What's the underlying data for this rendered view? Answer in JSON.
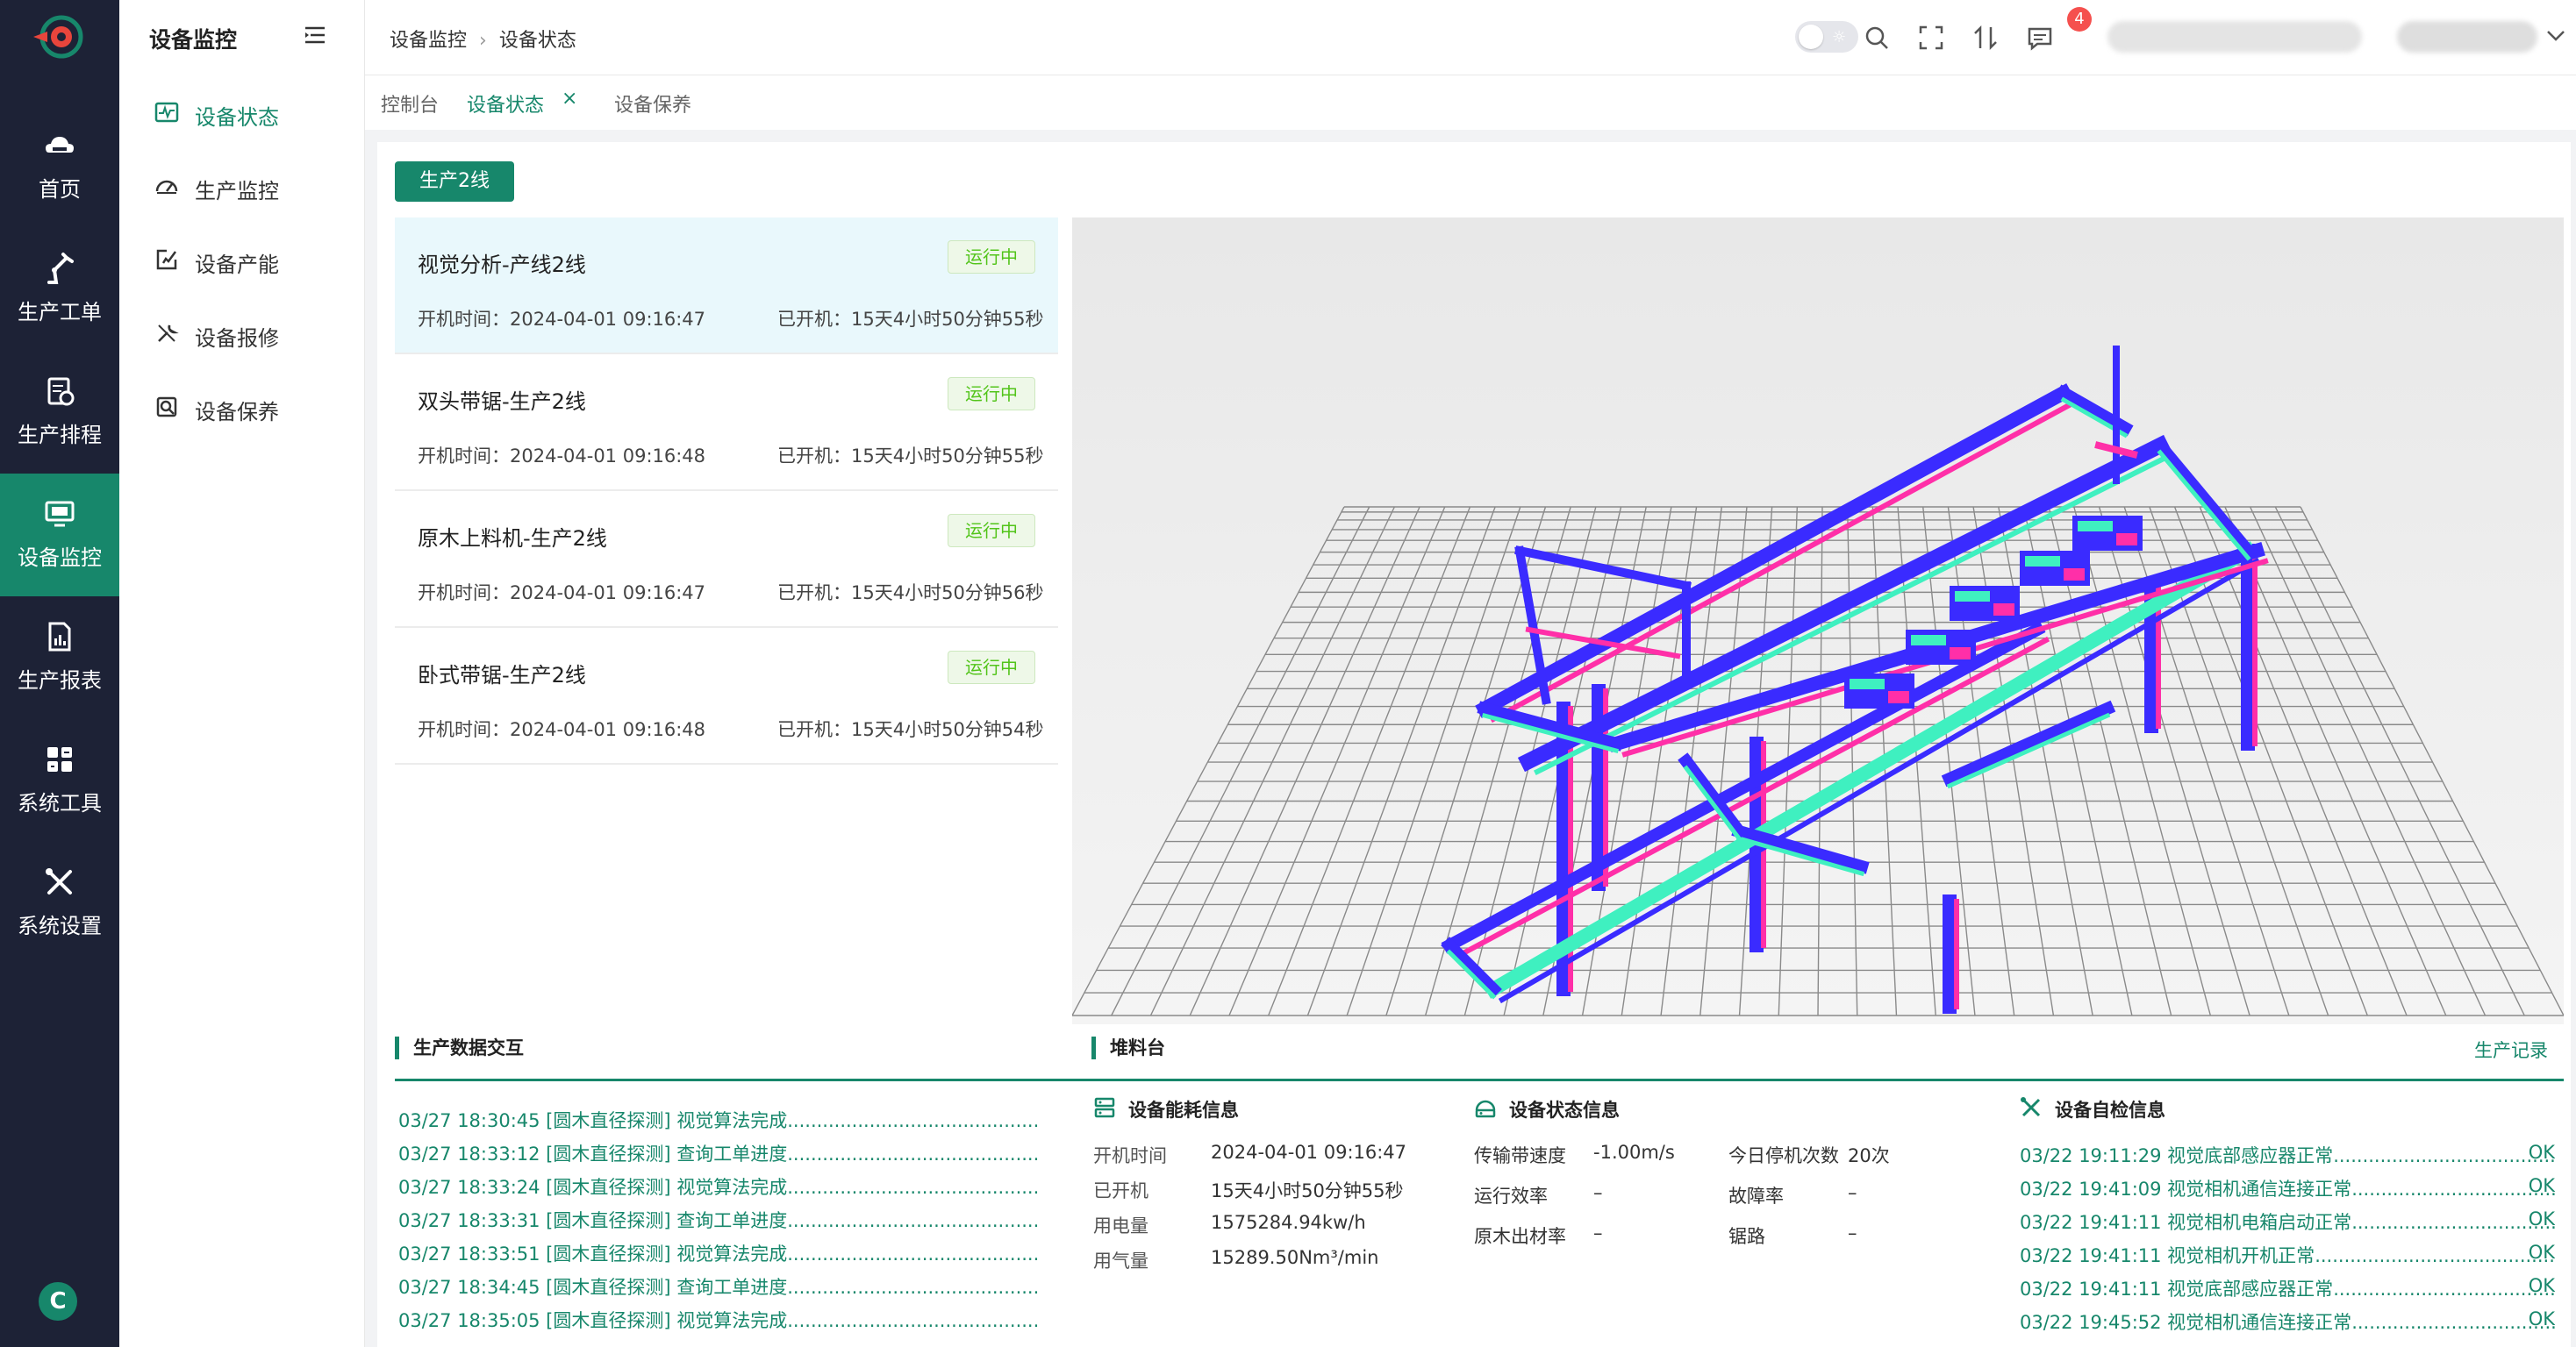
{
  "rail": {
    "items": [
      {
        "label": "首页",
        "icon": "home-cloud-icon"
      },
      {
        "label": "生产工单",
        "icon": "robot-arm-icon"
      },
      {
        "label": "生产排程",
        "icon": "schedule-clipboard-icon"
      },
      {
        "label": "设备监控",
        "icon": "monitor-icon"
      },
      {
        "label": "生产报表",
        "icon": "report-icon"
      },
      {
        "label": "系统工具",
        "icon": "grid-tools-icon"
      },
      {
        "label": "系统设置",
        "icon": "tools-cross-icon"
      }
    ],
    "active_index": 3,
    "bottom_logo": "C"
  },
  "sidebar": {
    "title": "设备监控",
    "items": [
      {
        "label": "设备状态",
        "icon": "waveform-icon"
      },
      {
        "label": "生产监控",
        "icon": "gauge-icon"
      },
      {
        "label": "设备产能",
        "icon": "edit-chart-icon"
      },
      {
        "label": "设备报修",
        "icon": "wrench-icon"
      },
      {
        "label": "设备保养",
        "icon": "maintenance-icon"
      }
    ],
    "active_index": 0
  },
  "header": {
    "breadcrumb": [
      "设备监控",
      "设备状态"
    ],
    "notification_count": "4"
  },
  "tabs": [
    {
      "label": "控制台"
    },
    {
      "label": "设备状态"
    },
    {
      "label": "设备保养"
    }
  ],
  "line_button": "生产2线",
  "devices": [
    {
      "name": "视觉分析-产线2线",
      "status": "运行中",
      "start": "开机时间：2024-04-01 09:16:47",
      "uptime": "已开机：15天4小时50分钟55秒"
    },
    {
      "name": "双头带锯-生产2线",
      "status": "运行中",
      "start": "开机时间：2024-04-01 09:16:48",
      "uptime": "已开机：15天4小时50分钟55秒"
    },
    {
      "name": "原木上料机-生产2线",
      "status": "运行中",
      "start": "开机时间：2024-04-01 09:16:47",
      "uptime": "已开机：15天4小时50分钟56秒"
    },
    {
      "name": "卧式带锯-生产2线",
      "status": "运行中",
      "start": "开机时间：2024-04-01 09:16:48",
      "uptime": "已开机：15天4小时50分钟54秒"
    }
  ],
  "sections": {
    "data_exchange": "生产数据交互",
    "stacking": "堆料台",
    "production_record": "生产记录"
  },
  "logs": [
    "03/27 18:30:45 [圆木直径探测] 视觉算法完成",
    "03/27 18:33:12 [圆木直径探测] 查询工单进度",
    "03/27 18:33:24 [圆木直径探测] 视觉算法完成",
    "03/27 18:33:31 [圆木直径探测] 查询工单进度",
    "03/27 18:33:51 [圆木直径探测] 视觉算法完成",
    "03/27 18:34:45 [圆木直径探测] 查询工单进度",
    "03/27 18:35:05 [圆木直径探测] 视觉算法完成"
  ],
  "energy": {
    "title": "设备能耗信息",
    "rows": [
      {
        "k": "开机时间",
        "v": "2024-04-01 09:16:47"
      },
      {
        "k": "已开机",
        "v": "15天4小时50分钟55秒"
      },
      {
        "k": "用电量",
        "v": "1575284.94kw/h"
      },
      {
        "k": "用气量",
        "v": "15289.50Nm³/min"
      }
    ]
  },
  "status_info": {
    "title": "设备状态信息",
    "left": [
      {
        "k": "传输带速度",
        "v": "-1.00m/s"
      },
      {
        "k": "运行效率",
        "v": "–"
      },
      {
        "k": "原木出材率",
        "v": "–"
      }
    ],
    "right": [
      {
        "k": "今日停机次数",
        "v": "20次"
      },
      {
        "k": "故障率",
        "v": "–"
      },
      {
        "k": "锯路",
        "v": "–"
      }
    ]
  },
  "self_check": {
    "title": "设备自检信息",
    "rows": [
      {
        "text": "03/22 19:11:29 视觉底部感应器正常",
        "ok": "OK"
      },
      {
        "text": "03/22 19:41:09 视觉相机通信连接正常",
        "ok": "OK"
      },
      {
        "text": "03/22 19:41:11 视觉相机电箱启动正常",
        "ok": "OK"
      },
      {
        "text": "03/22 19:41:11 视觉相机开机正常",
        "ok": "OK"
      },
      {
        "text": "03/22 19:41:11 视觉底部感应器正常",
        "ok": "OK"
      },
      {
        "text": "03/22 19:45:52 视觉相机通信连接正常",
        "ok": "OK"
      }
    ]
  },
  "colors": {
    "accent": "#17876b",
    "rail_bg": "#1d2236",
    "running": "#52c41a",
    "badge": "#f5504e"
  }
}
